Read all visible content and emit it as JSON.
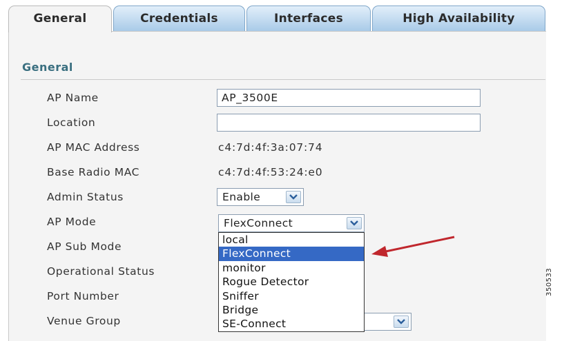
{
  "tabs": [
    {
      "label": "General",
      "active": true
    },
    {
      "label": "Credentials",
      "active": false
    },
    {
      "label": "Interfaces",
      "active": false
    },
    {
      "label": "High Availability",
      "active": false
    }
  ],
  "section": {
    "title": "General"
  },
  "fields": {
    "ap_name": {
      "label": "AP Name",
      "value": "AP_3500E"
    },
    "location": {
      "label": "Location",
      "value": ""
    },
    "ap_mac": {
      "label": "AP MAC Address",
      "value": "c4:7d:4f:3a:07:74"
    },
    "base_radio_mac": {
      "label": "Base Radio MAC",
      "value": "c4:7d:4f:53:24:e0"
    },
    "admin_status": {
      "label": "Admin Status",
      "value": "Enable"
    },
    "ap_mode": {
      "label": "AP Mode",
      "value": "FlexConnect"
    },
    "ap_sub_mode": {
      "label": "AP Sub Mode"
    },
    "operational_status": {
      "label": "Operational Status"
    },
    "port_number": {
      "label": "Port Number"
    },
    "venue_group": {
      "label": "Venue Group"
    }
  },
  "dropdown": {
    "options": [
      "local",
      "FlexConnect",
      "monitor",
      "Rogue Detector",
      "Sniffer",
      "Bridge",
      "SE-Connect"
    ],
    "selected": "FlexConnect"
  },
  "figure_id": "350533",
  "colors": {
    "selection": "#3569c5",
    "arrow": "#c0272d",
    "section_title": "#3a6f80",
    "tab_active_bg": "#f4f4f4"
  }
}
